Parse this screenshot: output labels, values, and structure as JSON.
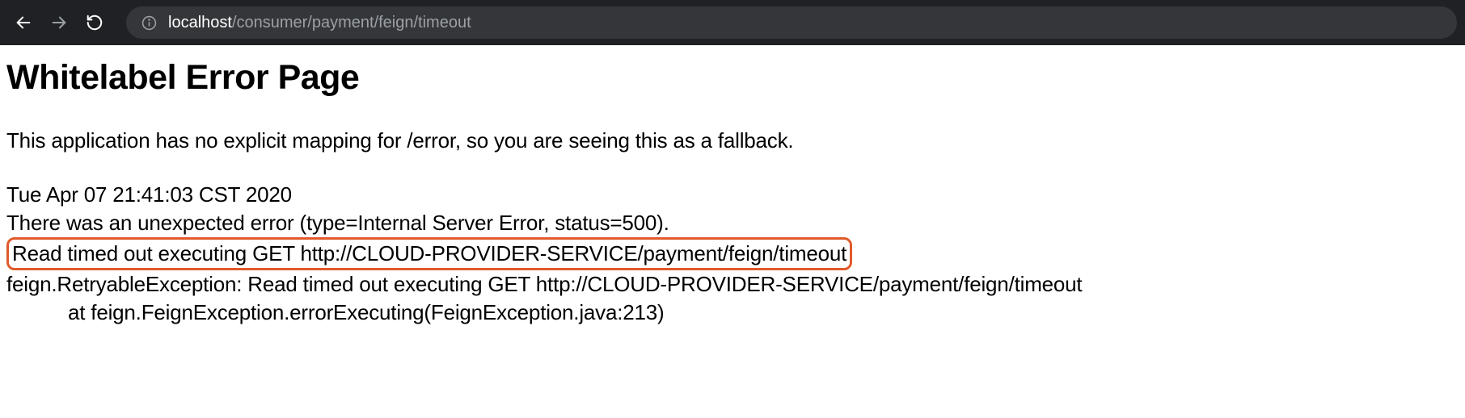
{
  "browser": {
    "url_host": "localhost",
    "url_path": "/consumer/payment/feign/timeout"
  },
  "page": {
    "title": "Whitelabel Error Page",
    "description": "This application has no explicit mapping for /error, so you are seeing this as a fallback.",
    "timestamp": "Tue Apr 07 21:41:03 CST 2020",
    "error_summary": "There was an unexpected error (type=Internal Server Error, status=500).",
    "error_message": "Read timed out executing GET http://CLOUD-PROVIDER-SERVICE/payment/feign/timeout",
    "exception_line": "feign.RetryableException: Read timed out executing GET http://CLOUD-PROVIDER-SERVICE/payment/feign/timeout",
    "stack_line": "at feign.FeignException.errorExecuting(FeignException.java:213)"
  }
}
